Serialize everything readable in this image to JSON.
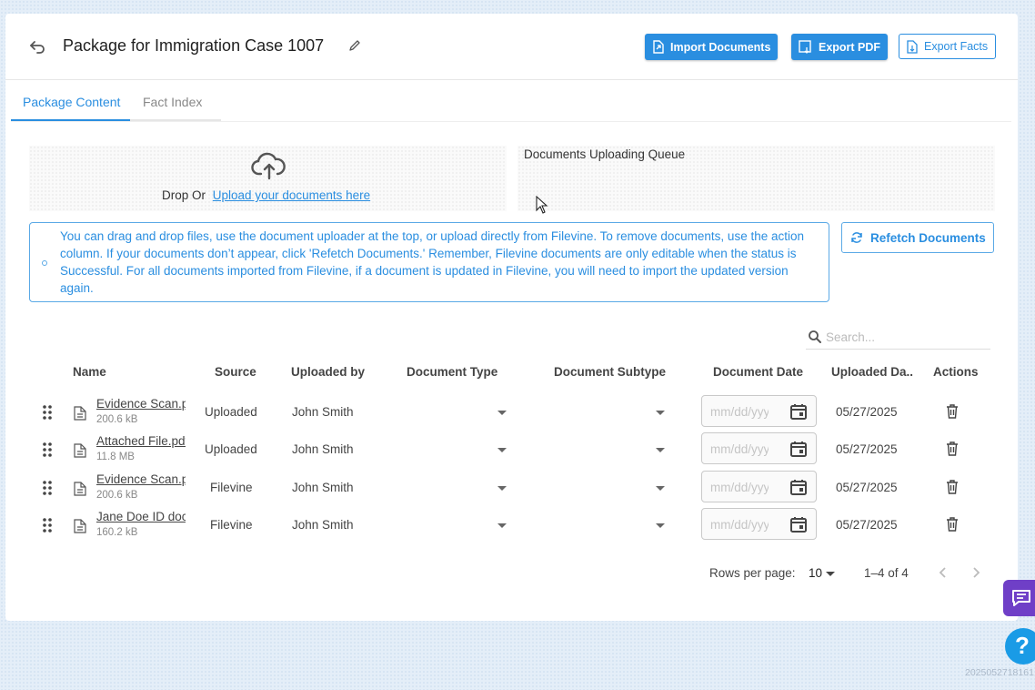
{
  "header": {
    "title": "Package for Immigration Case 1007",
    "import_label": "Import Documents",
    "export_pdf_label": "Export PDF",
    "export_facts_label": "Export Facts"
  },
  "tabs": [
    {
      "label": "Package Content",
      "active": true
    },
    {
      "label": "Fact Index",
      "active": false
    }
  ],
  "upload": {
    "drop_text": "Drop Or",
    "link_text": "Upload your documents here",
    "queue_title": "Documents Uploading Queue"
  },
  "info": {
    "text": "You can drag and drop files, use the document uploader at the top, or upload directly from Filevine. To remove documents, use the action column. If your documents don’t appear, click 'Refetch Documents.' Remember, Filevine documents are only editable when the status is Successful. For all documents imported from Filevine, if a document is updated in Filevine, you will need to import the updated version again.",
    "refetch_label": "Refetch Documents"
  },
  "search": {
    "placeholder": "Search..."
  },
  "table": {
    "columns": [
      "Name",
      "Source",
      "Uploaded by",
      "Document Type",
      "Document Subtype",
      "Document Date",
      "Uploaded Da...",
      "Actions"
    ],
    "date_placeholder": "mm/dd/yyyy",
    "rows": [
      {
        "name": "Evidence Scan.pdf",
        "size": "200.6 kB",
        "source": "Uploaded",
        "uploaded_by": "John Smith",
        "uploaded_date": "05/27/2025"
      },
      {
        "name": "Attached File.pdf",
        "size": "11.8 MB",
        "source": "Uploaded",
        "uploaded_by": "John Smith",
        "uploaded_date": "05/27/2025"
      },
      {
        "name": "Evidence Scan.pdf",
        "size": "200.6 kB",
        "source": "Filevine",
        "uploaded_by": "John Smith",
        "uploaded_date": "05/27/2025"
      },
      {
        "name": "Jane Doe ID doc",
        "size": "160.2 kB",
        "source": "Filevine",
        "uploaded_by": "John Smith",
        "uploaded_date": "05/27/2025"
      }
    ]
  },
  "pagination": {
    "rows_per_page_label": "Rows per page:",
    "rows_per_page": "10",
    "range": "1–4 of 4"
  },
  "stamp": "2025052718161",
  "colors": {
    "accent": "#2a8ee0",
    "chat": "#6f3fc7",
    "help": "#1a9be6"
  }
}
